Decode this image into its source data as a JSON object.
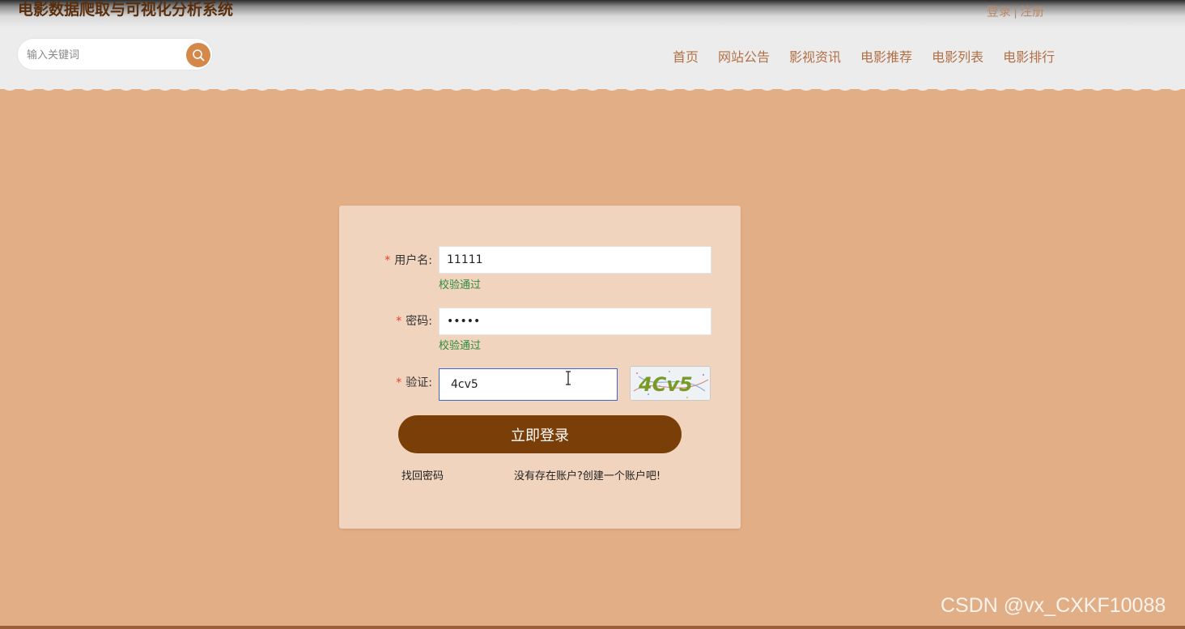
{
  "header": {
    "site_title": "电影数据爬取与可视化分析系统",
    "login_link": "登录",
    "separator": "|",
    "register_link": "注册"
  },
  "search": {
    "placeholder": "输入关键词",
    "icon": "search-icon"
  },
  "nav": {
    "items": [
      "首页",
      "网站公告",
      "影视资讯",
      "电影推荐",
      "电影列表",
      "电影排行"
    ]
  },
  "form": {
    "required_mark": "*",
    "username": {
      "label": "用户名:",
      "value": "11111",
      "hint": "校验通过"
    },
    "password": {
      "label": "密码:",
      "value": "11111",
      "hint": "校验通过"
    },
    "captcha": {
      "label": "验证:",
      "value": "4cv5",
      "image_text": "4Cv5"
    },
    "submit_label": "立即登录",
    "forgot_password": "找回密码",
    "register_prompt": "没有存在账户?创建一个账户吧!"
  },
  "watermark": "CSDN @vx_CXKF10088",
  "colors": {
    "background": "#e2ae85",
    "card": "#f1d4be",
    "button": "#7a3f08",
    "accent": "#d4884a",
    "nav_text": "#b17046",
    "success": "#2e8b3d",
    "required": "#e53d30"
  }
}
